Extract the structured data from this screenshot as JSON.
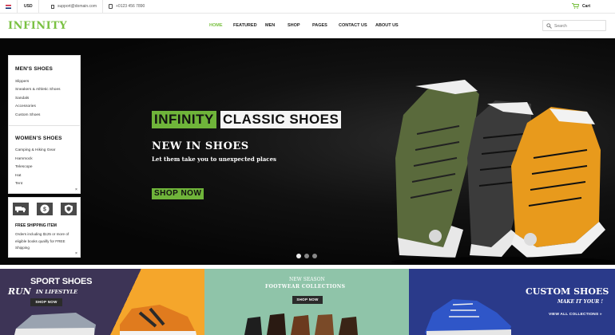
{
  "topbar": {
    "currency": "USD",
    "email": "support@domain.com",
    "phone": "+0123 456 7890",
    "cart_label": "Cart"
  },
  "header": {
    "logo": "INFINITY",
    "nav": [
      "HOME",
      "FEATURED",
      "MEN",
      "SHOP",
      "PAGES",
      "CONTACT US",
      "ABOUT US"
    ],
    "active_nav": "HOME",
    "search_placeholder": "Search"
  },
  "sidebar": {
    "men_title": "MEN'S SHOES",
    "men_items": [
      "Slippers",
      "Sneakers & Athletic Shoes",
      "Sandals",
      "Accessories",
      "Custom Shoes"
    ],
    "women_title": "WOMEN'S SHOES",
    "women_items": [
      "Camping & Hiking Gear",
      "Hammock",
      "Telescope",
      "Hat",
      "Tent"
    ],
    "close_symbol": "×"
  },
  "shipping": {
    "title": "FREE SHIPPING ITEM",
    "text": "Orders including $125 or more of eligible books qualify for FREE Shipping",
    "close_symbol": "×",
    "icons": [
      "truck-icon",
      "dollar-icon",
      "shield-icon"
    ]
  },
  "hero": {
    "tag_green": "INFINITY",
    "tag_white": "CLASSIC SHOES",
    "heading": "NEW IN SHOES",
    "subheading": "Let them take you to unexpected places",
    "button": "SHOP NOW",
    "slide_count": 3,
    "active_slide": 1
  },
  "banners": [
    {
      "title": "SPORT SHOES",
      "run": "RUN",
      "subtitle": "IN LIFESTYLE",
      "button": "SHOP NOW"
    },
    {
      "kicker": "NEW SEASON",
      "title": "FOOTWEAR COLLECTIONS",
      "button": "SHOP NOW"
    },
    {
      "title": "CUSTOM SHOES",
      "subtitle": "MAKE IT YOUR !",
      "link": "VIEW ALL COLLECTIONS »"
    }
  ],
  "colors": {
    "accent": "#7ac142",
    "hero_bg": "#0a0a0a",
    "banner_purple": "#3d3456",
    "banner_orange": "#f5a62b",
    "banner_mint": "#8fc4a9",
    "banner_blue": "#2a3a8a"
  }
}
